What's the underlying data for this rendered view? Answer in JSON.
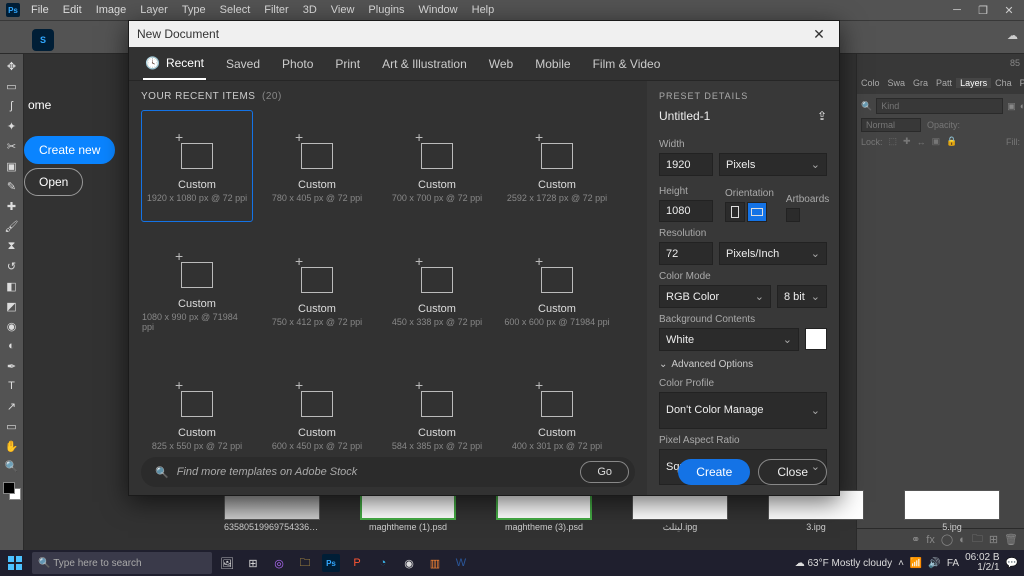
{
  "menubar": {
    "items": [
      "File",
      "Edit",
      "Image",
      "Layer",
      "Type",
      "Select",
      "Filter",
      "3D",
      "View",
      "Plugins",
      "Window",
      "Help"
    ]
  },
  "home": {
    "label": "ome",
    "create": "Create new",
    "open": "Open"
  },
  "thumbs": [
    {
      "name": "63580519969754336.ipg"
    },
    {
      "name": "maghtheme (1).psd"
    },
    {
      "name": "maghtheme (3).psd"
    },
    {
      "name": "لیثلث.ipg"
    },
    {
      "name": "3.ipg"
    },
    {
      "name": "5.ipg"
    }
  ],
  "layersPanel": {
    "tabs": [
      "Colo",
      "Swa",
      "Gra",
      "Patt",
      "Layers",
      "Cha",
      "Path"
    ],
    "kind": "Kind",
    "blend": "Normal",
    "opacityLabel": "Opacity:",
    "lockLabel": "Lock:",
    "fillLabel": "Fill:"
  },
  "dialog": {
    "title": "New Document",
    "tabs": [
      "Recent",
      "Saved",
      "Photo",
      "Print",
      "Art & Illustration",
      "Web",
      "Mobile",
      "Film & Video"
    ],
    "recentHead": "YOUR RECENT ITEMS",
    "recentCount": "(20)",
    "stockPlaceholder": "Find more templates on Adobe Stock",
    "goLabel": "Go",
    "presets": [
      {
        "name": "Custom",
        "dims": "1920 x 1080 px @ 72 ppi"
      },
      {
        "name": "Custom",
        "dims": "780 x 405 px @ 72 ppi"
      },
      {
        "name": "Custom",
        "dims": "700 x 700 px @ 72 ppi"
      },
      {
        "name": "Custom",
        "dims": "2592 x 1728 px @ 72 ppi"
      },
      {
        "name": "Custom",
        "dims": "1080 x 990 px @ 71984 ppi"
      },
      {
        "name": "Custom",
        "dims": "750 x 412 px @ 72 ppi"
      },
      {
        "name": "Custom",
        "dims": "450 x 338 px @ 72 ppi"
      },
      {
        "name": "Custom",
        "dims": "600 x 600 px @ 71984 ppi"
      },
      {
        "name": "Custom",
        "dims": "825 x 550 px @ 72 ppi"
      },
      {
        "name": "Custom",
        "dims": "600 x 450 px @ 72 ppi"
      },
      {
        "name": "Custom",
        "dims": "584 x 385 px @ 72 ppi"
      },
      {
        "name": "Custom",
        "dims": "400 x 301 px @ 72 ppi"
      }
    ],
    "details": {
      "head": "PRESET DETAILS",
      "name": "Untitled-1",
      "widthLabel": "Width",
      "width": "1920",
      "widthUnit": "Pixels",
      "heightLabel": "Height",
      "height": "1080",
      "orientLabel": "Orientation",
      "artboardLabel": "Artboards",
      "resLabel": "Resolution",
      "res": "72",
      "resUnit": "Pixels/Inch",
      "colorLabel": "Color Mode",
      "color": "RGB Color",
      "bits": "8 bit",
      "bgLabel": "Background Contents",
      "bg": "White",
      "adv": "Advanced Options",
      "profileLabel": "Color Profile",
      "profile": "Don't Color Manage",
      "pixelLabel": "Pixel Aspect Ratio",
      "pixel": "Square Pixels"
    },
    "createBtn": "Create",
    "closeBtn": "Close"
  },
  "taskbar": {
    "search": "Type here to search",
    "weather": "63°F Mostly cloudy",
    "time": "06:02 B",
    "date": "1/2/1"
  }
}
